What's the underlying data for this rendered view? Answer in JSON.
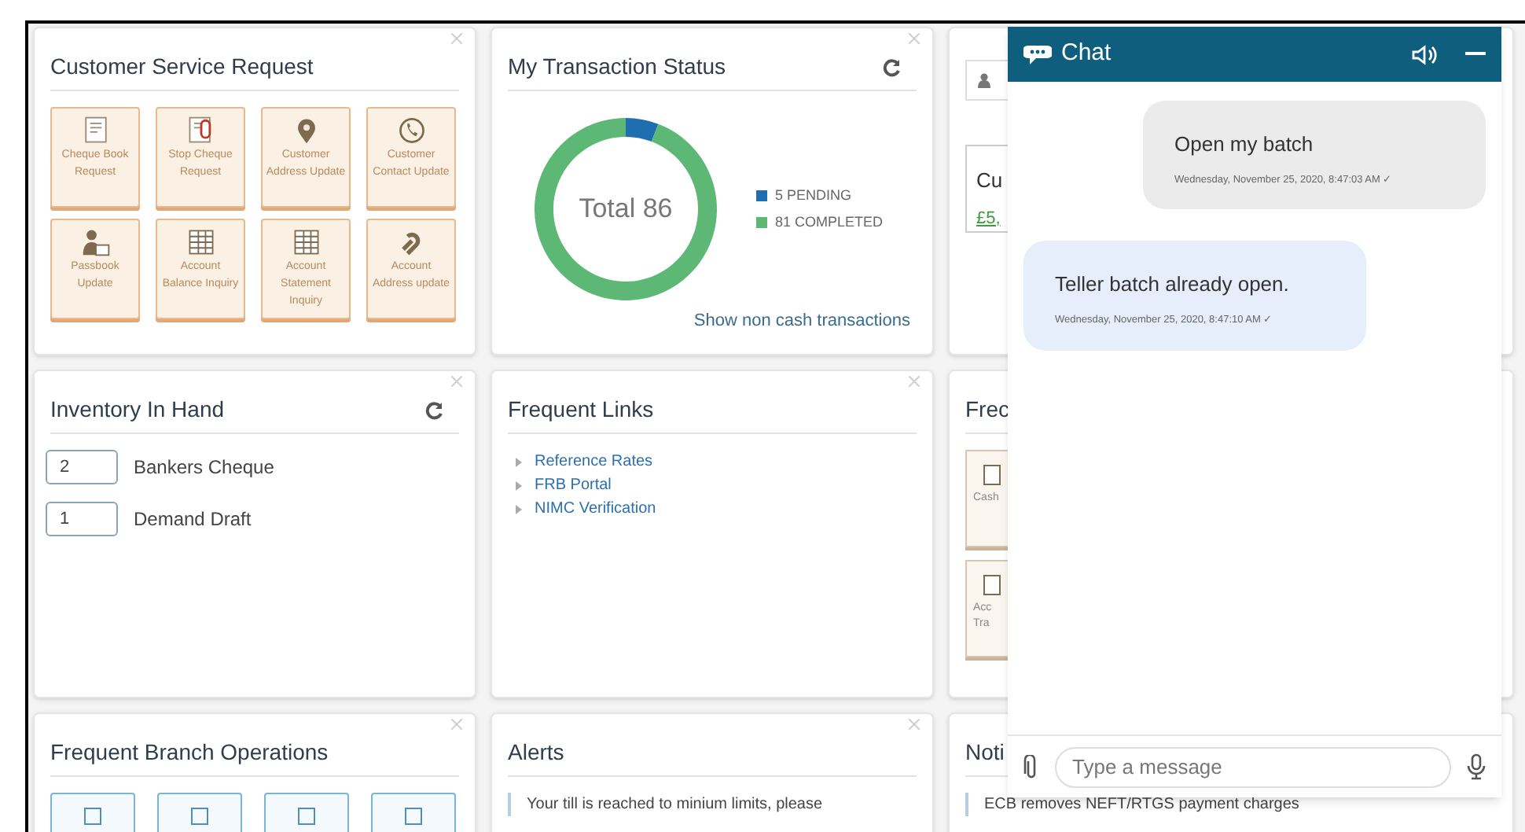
{
  "customer_service_request": {
    "title": "Customer Service Request",
    "tiles": [
      {
        "label": "Cheque Book Request"
      },
      {
        "label": "Stop Cheque Request"
      },
      {
        "label": "Customer Address Update"
      },
      {
        "label": "Customer Contact Update"
      },
      {
        "label": "Passbook Update"
      },
      {
        "label": "Account Balance Inquiry"
      },
      {
        "label": "Account Statement Inquiry"
      },
      {
        "label": "Account Address update"
      }
    ]
  },
  "transaction_status": {
    "title": "My Transaction Status",
    "center_label": "Total 86",
    "chart_data": {
      "type": "donut",
      "categories": [
        "5 PENDING",
        "81 COMPLETED"
      ],
      "values": [
        5,
        81
      ],
      "colors": [
        "#1f6fb0",
        "#5cb874"
      ]
    },
    "link": "Show non cash transactions"
  },
  "customer_card": {
    "name": "Cu",
    "amount": "£5,"
  },
  "inventory": {
    "title": "Inventory In Hand",
    "items": [
      {
        "value": "2",
        "label": "Bankers Cheque"
      },
      {
        "value": "1",
        "label": "Demand Draft"
      }
    ]
  },
  "frequent_links": {
    "title": "Frequent Links",
    "links": [
      "Reference Rates",
      "FRB Portal",
      "NIMC Verification"
    ]
  },
  "frequent_cut": {
    "title": "Frec",
    "tiles": [
      [
        "Cash"
      ],
      [
        "Acc",
        "Tra"
      ]
    ]
  },
  "branch_operations": {
    "title": "Frequent Branch Operations"
  },
  "alerts": {
    "title": "Alerts",
    "items": [
      "Your till is reached to minium limits, please"
    ]
  },
  "notifications": {
    "title": "Noti",
    "items": [
      "ECB removes NEFT/RTGS payment charges"
    ]
  },
  "chat": {
    "title": "Chat",
    "messages": [
      {
        "kind": "sent",
        "text": "Open my batch",
        "time": "Wednesday, November 25, 2020, 8:47:03 AM ✓"
      },
      {
        "kind": "received",
        "text": "Teller batch already open.",
        "time": "Wednesday, November 25, 2020, 8:47:10 AM ✓"
      }
    ],
    "placeholder": "Type a message"
  }
}
